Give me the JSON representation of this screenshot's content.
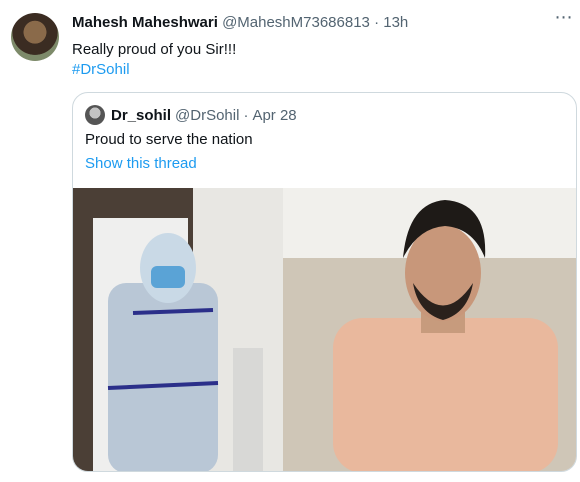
{
  "tweet": {
    "author_name": "Mahesh Maheshwari",
    "handle": "@MaheshM73686813",
    "separator": "·",
    "time": "13h",
    "text": "Really proud of you Sir!!!",
    "hashtag": "#DrSohil",
    "more_icon": "more-icon"
  },
  "quote": {
    "author_name": "Dr_sohil",
    "handle": "@DrSohil",
    "separator": "·",
    "date": "Apr 28",
    "text": "Proud to serve the nation",
    "thread_link": "Show this thread"
  },
  "colors": {
    "link": "#1d9bf0",
    "secondary_text": "#536471",
    "border": "#cfd9de"
  }
}
